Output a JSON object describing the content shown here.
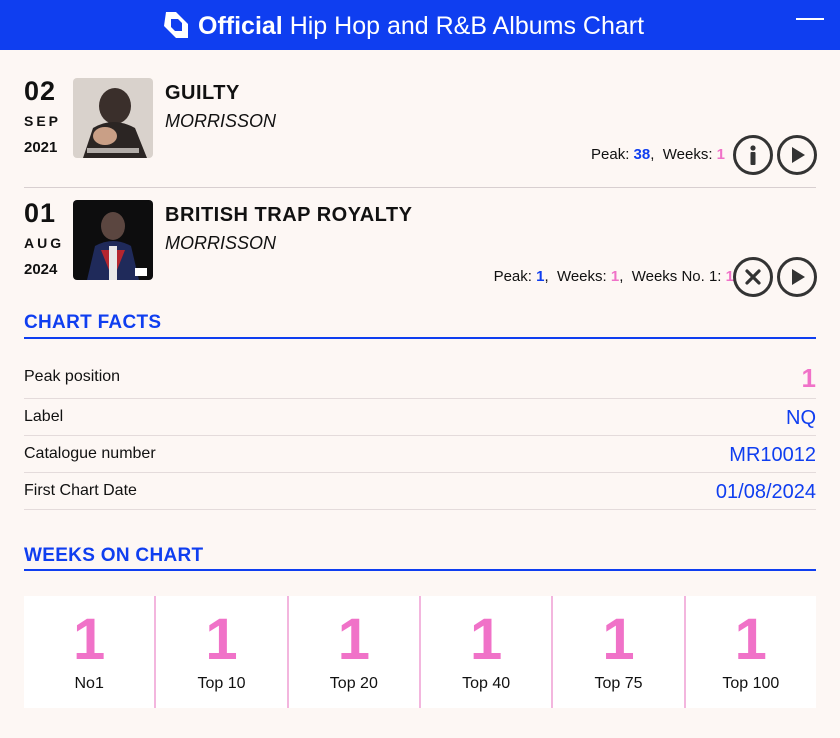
{
  "header": {
    "title_bold": "Official",
    "title_rest": " Hip Hop and R&B Albums Chart"
  },
  "entries": [
    {
      "day": "02",
      "month": "SEP",
      "year": "2021",
      "title": "GUILTY",
      "artist": "MORRISSON",
      "stats": {
        "peak_label": "Peak: ",
        "peak": "38",
        "weeks_label": "Weeks: ",
        "weeks": "1"
      },
      "actions": [
        "info-icon",
        "play-icon"
      ]
    },
    {
      "day": "01",
      "month": "AUG",
      "year": "2024",
      "title": "BRITISH TRAP ROYALTY",
      "artist": "MORRISSON",
      "stats": {
        "peak_label": "Peak: ",
        "peak": "1",
        "weeks_label": "Weeks: ",
        "weeks": "1",
        "weeks_no1_label": "Weeks No. 1: ",
        "weeks_no1": "1"
      },
      "actions": [
        "close-icon",
        "play-icon"
      ]
    }
  ],
  "chart_facts": {
    "heading": "CHART FACTS",
    "rows": [
      {
        "label": "Peak position",
        "value": "1"
      },
      {
        "label": "Label",
        "value": "NQ"
      },
      {
        "label": "Catalogue number",
        "value": "MR10012"
      },
      {
        "label": "First Chart Date",
        "value": "01/08/2024"
      }
    ]
  },
  "weeks_on_chart": {
    "heading": "WEEKS ON CHART",
    "cells": [
      {
        "value": "1",
        "label": "No1"
      },
      {
        "value": "1",
        "label": "Top 10"
      },
      {
        "value": "1",
        "label": "Top 20"
      },
      {
        "value": "1",
        "label": "Top 40"
      },
      {
        "value": "1",
        "label": "Top 75"
      },
      {
        "value": "1",
        "label": "Top 100"
      }
    ]
  },
  "colors": {
    "brand_blue": "#0f3ef0",
    "accent_pink": "#f072c8",
    "background": "#fdf7f4"
  }
}
